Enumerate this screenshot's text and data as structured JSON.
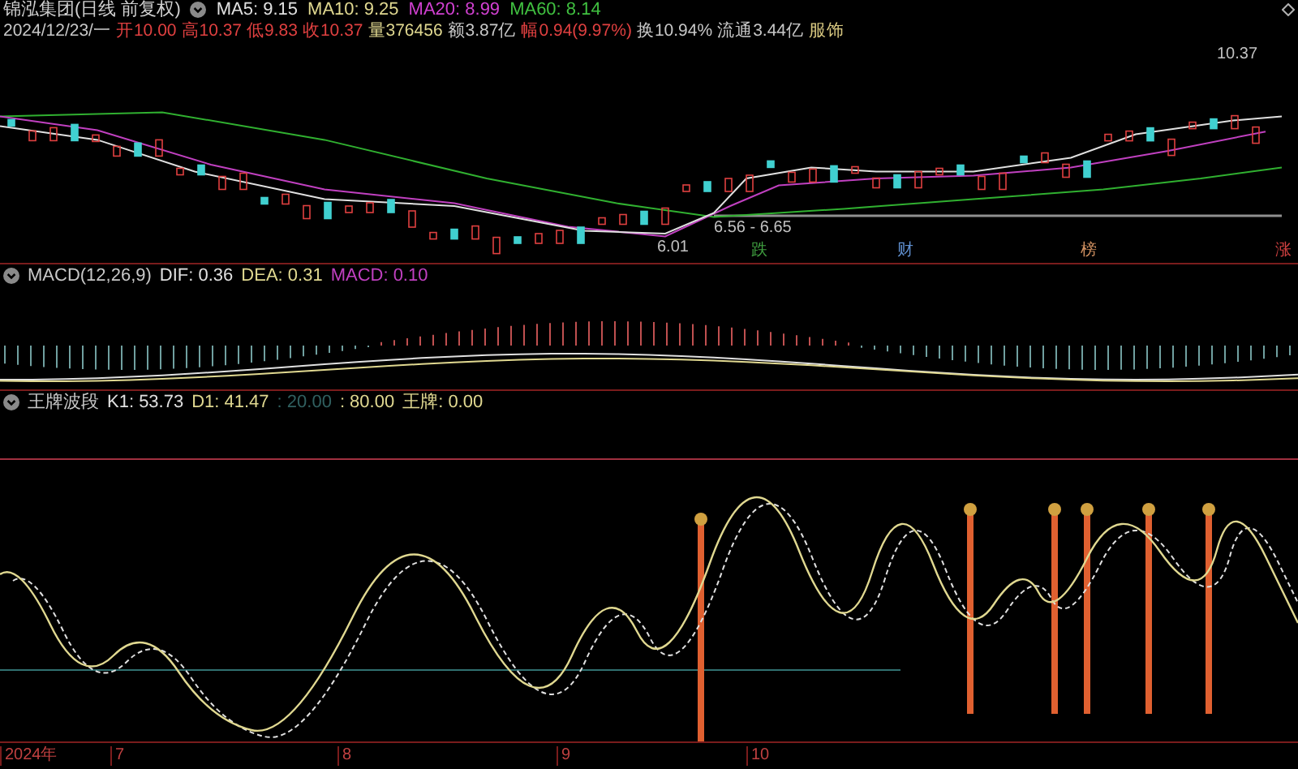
{
  "header": {
    "stock": "锦泓集团(日线 前复权)",
    "indicators": [
      {
        "text": "MA5: 9.15",
        "color": "#e0e0e0"
      },
      {
        "text": "MA10: 9.25",
        "color": "#e0d890"
      },
      {
        "text": "MA20: 8.99",
        "color": "#d040d0"
      },
      {
        "text": "MA60: 8.14",
        "color": "#40c040"
      }
    ]
  },
  "quote_line": [
    {
      "text": "2024/12/23/一",
      "color": "#c8c8c8"
    },
    {
      "text": "开10.00",
      "color": "#e04040"
    },
    {
      "text": "高10.37",
      "color": "#e04040"
    },
    {
      "text": "低9.83",
      "color": "#e04040"
    },
    {
      "text": "收10.37",
      "color": "#e04040"
    },
    {
      "text": "量376456",
      "color": "#e0d890"
    },
    {
      "text": "额3.87亿",
      "color": "#c8c8c8"
    },
    {
      "text": "幅0.94(9.97%)",
      "color": "#e04040"
    },
    {
      "text": "换10.94%",
      "color": "#c8c8c8"
    },
    {
      "text": "流通3.44亿",
      "color": "#c8c8c8"
    },
    {
      "text": "服饰",
      "color": "#d8c880"
    }
  ],
  "price_chart": {
    "high_label": "10.37",
    "range_label": "6.56 - 6.65",
    "low_label": "6.01"
  },
  "events": [
    {
      "text": "跌",
      "color": "#40a040"
    },
    {
      "text": "财",
      "color": "#6090d0"
    },
    {
      "text": "榜",
      "color": "#d09060"
    },
    {
      "text": "涨",
      "color": "#d04040"
    }
  ],
  "macd_panel": {
    "title": "MACD(12,26,9)",
    "values": [
      {
        "text": "DIF: 0.36",
        "color": "#e0e0e0"
      },
      {
        "text": "DEA: 0.31",
        "color": "#e0d890"
      },
      {
        "text": "MACD: 0.10",
        "color": "#c040c0"
      }
    ]
  },
  "wave_panel": {
    "title": "王牌波段",
    "values": [
      {
        "text": "K1: 53.73",
        "color": "#e0e0e0"
      },
      {
        "text": "D1: 41.47",
        "color": "#e0d890"
      },
      {
        "text": ": 20.00",
        "color": "#306060"
      },
      {
        "text": ": 80.00",
        "color": "#e0d890"
      },
      {
        "text": "王牌: 0.00",
        "color": "#e0d890"
      }
    ]
  },
  "x_axis": [
    "2024年",
    "7",
    "8",
    "9",
    "10"
  ]
}
